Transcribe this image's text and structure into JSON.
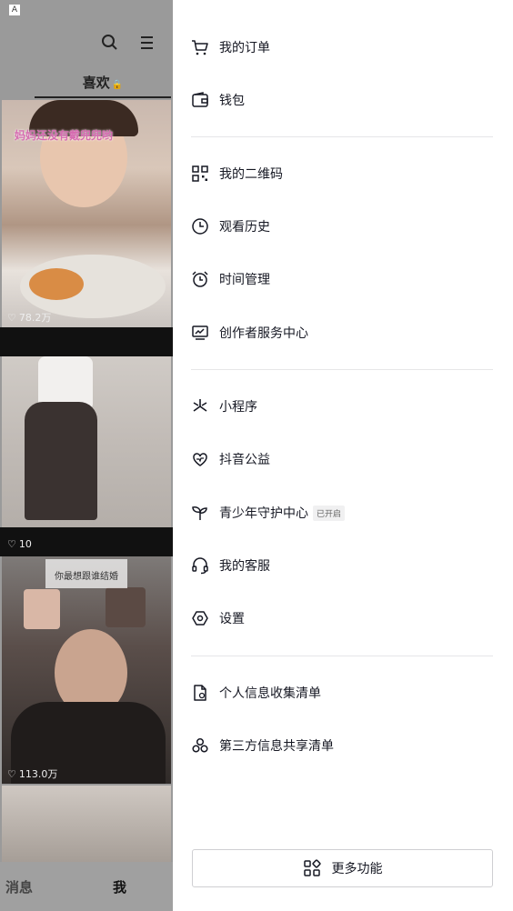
{
  "left_page": {
    "status_letter": "A",
    "tab_label": "喜欢",
    "thumb1_caption": "妈妈还没有戴兜兜哟",
    "thumb1_likes": "78.2万",
    "thumb2_likes": "10",
    "thumb3_overlay": "你最想跟谁结婚",
    "thumb3_likes": "113.0万",
    "nav_messages": "消息",
    "nav_me": "我"
  },
  "drawer": {
    "items": [
      {
        "label": "我的订单",
        "icon": "cart-icon"
      },
      {
        "label": "钱包",
        "icon": "wallet-icon"
      },
      {
        "label": "我的二维码",
        "icon": "qr-code-icon"
      },
      {
        "label": "观看历史",
        "icon": "clock-icon"
      },
      {
        "label": "时间管理",
        "icon": "alarm-icon"
      },
      {
        "label": "创作者服务中心",
        "icon": "creator-chart-icon"
      },
      {
        "label": "小程序",
        "icon": "mini-program-icon"
      },
      {
        "label": "抖音公益",
        "icon": "charity-heart-icon"
      },
      {
        "label": "青少年守护中心",
        "icon": "sprout-icon",
        "badge": "已开启"
      },
      {
        "label": "我的客服",
        "icon": "headset-icon"
      },
      {
        "label": "设置",
        "icon": "settings-hexagon-icon"
      },
      {
        "label": "个人信息收集清单",
        "icon": "document-check-icon"
      },
      {
        "label": "第三方信息共享清单",
        "icon": "share-circles-icon"
      }
    ],
    "more_button": "更多功能"
  },
  "colors": {
    "text": "#161823",
    "divider": "#e6e6e8",
    "dim_overlay": "#9a9a9a"
  }
}
